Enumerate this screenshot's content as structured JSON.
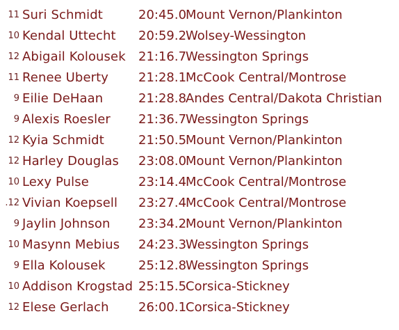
{
  "results": [
    {
      "grade": "11",
      "name": "Suri Schmidt",
      "time": "20:45.0",
      "team": "Mount Vernon/Plankinton"
    },
    {
      "grade": "10",
      "name": "Kendal Uttecht",
      "time": "20:59.2",
      "team": "Wolsey-Wessington"
    },
    {
      "grade": "12",
      "name": "Abigail Kolousek",
      "time": "21:16.7",
      "team": "Wessington Springs"
    },
    {
      "grade": "11",
      "name": "Renee Uberty",
      "time": "21:28.1",
      "team": "McCook Central/Montrose"
    },
    {
      "grade": "9",
      "name": "Eilie DeHaan",
      "time": "21:28.8",
      "team": "Andes Central/Dakota Christian"
    },
    {
      "grade": "9",
      "name": "Alexis Roesler",
      "time": "21:36.7",
      "team": "Wessington Springs"
    },
    {
      "grade": "12",
      "name": "Kyia Schmidt",
      "time": "21:50.5",
      "team": "Mount Vernon/Plankinton"
    },
    {
      "grade": "12",
      "name": "Harley Douglas",
      "time": "23:08.0",
      "team": "Mount Vernon/Plankinton"
    },
    {
      "grade": "10",
      "name": "Lexy Pulse",
      "time": "23:14.4",
      "team": "McCook Central/Montrose"
    },
    {
      "grade": ".12",
      "name": "Vivian Koepsell",
      "time": "23:27.4",
      "team": "McCook Central/Montrose"
    },
    {
      "grade": "9",
      "name": "Jaylin Johnson",
      "time": "23:34.2",
      "team": "Mount Vernon/Plankinton"
    },
    {
      "grade": "10",
      "name": "Masynn Mebius",
      "time": "24:23.3",
      "team": "Wessington Springs"
    },
    {
      "grade": "9",
      "name": "Ella Kolousek",
      "time": "25:12.8",
      "team": "Wessington Springs"
    },
    {
      "grade": "10",
      "name": "Addison Krogstad",
      "time": "25:15.5",
      "team": "Corsica-Stickney"
    },
    {
      "grade": "12",
      "name": "Elese Gerlach",
      "time": "26:00.1",
      "team": "Corsica-Stickney"
    }
  ],
  "colors": {
    "text": "#7a1a1a",
    "grade": "#6b2020",
    "background": "#ffffff"
  }
}
